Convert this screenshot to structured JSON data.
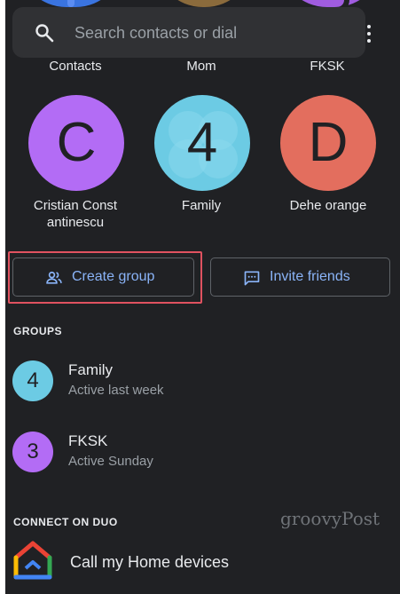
{
  "search": {
    "placeholder": "Search contacts or dial",
    "icon": "search-icon",
    "menu_icon": "more-vert-icon"
  },
  "top_row": [
    {
      "label": "Contacts"
    },
    {
      "label": "Mom"
    },
    {
      "label": "FKSK"
    }
  ],
  "favorites": [
    {
      "initial": "C",
      "name": "Cristian Constantinescu",
      "name_line1": "Cristian Const",
      "name_line2": "antinescu",
      "color": "#b36cf5"
    },
    {
      "initial": "4",
      "name": "Family",
      "color": "#6ccbe4"
    },
    {
      "initial": "D",
      "name": "Dehe orange",
      "color": "#e36e5e"
    }
  ],
  "actions": {
    "create_group": "Create group",
    "invite_friends": "Invite friends"
  },
  "groups": {
    "heading": "GROUPS",
    "items": [
      {
        "avatar": "4",
        "name": "Family",
        "status": "Active last week",
        "color": "#6ccbe4"
      },
      {
        "avatar": "3",
        "name": "FKSK",
        "status": "Active Sunday",
        "color": "#b36cf5"
      }
    ]
  },
  "connect": {
    "heading": "CONNECT ON DUO",
    "item_label": "Call my Home devices",
    "icon": "google-home-icon"
  },
  "watermark": "groovyPost",
  "colors": {
    "background": "#202124",
    "accent": "#8ab4f8",
    "highlight": "#e05260"
  }
}
